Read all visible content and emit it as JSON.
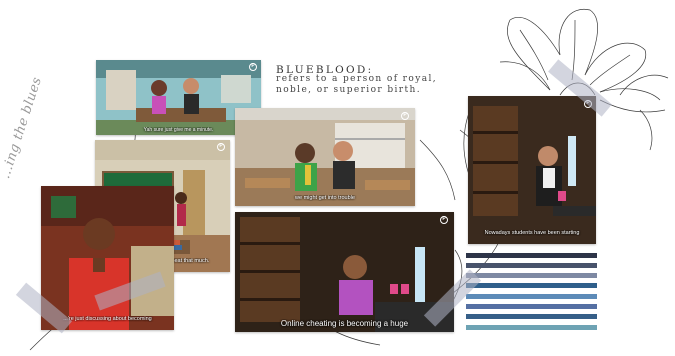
{
  "heading": {
    "title": "BLUEBLOOD:",
    "definition_line1": "refers to a person of royal,",
    "definition_line2": "noble, or superior birth."
  },
  "script_text": "...ing the blues",
  "logo_text": "Plotagon",
  "scenes": [
    {
      "caption": "Yah sure just give me a minute."
    },
    {
      "caption": "we might get into trouble"
    },
    {
      "caption": "Because we all didn't cheat that much."
    },
    {
      "caption": "Nowadays students have been starting"
    },
    {
      "caption": "...'re just discussing about becoming"
    },
    {
      "caption": "Online cheating is becoming a huge"
    }
  ],
  "stripe_colors": [
    "#2d3448",
    "#48536b",
    "#7e89a3",
    "#2f5f8b",
    "#5d8bb8",
    "#5570a3",
    "#365f88",
    "#6ea3b4"
  ],
  "accent_colors": {
    "tape": "#afb2c4",
    "text": "#333333"
  }
}
